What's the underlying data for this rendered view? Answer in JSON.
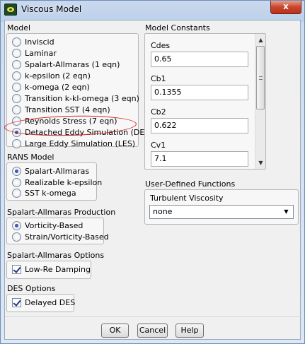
{
  "window": {
    "title": "Viscous Model",
    "close_label": "x"
  },
  "model": {
    "title": "Model",
    "options": [
      {
        "label": "Inviscid",
        "selected": false
      },
      {
        "label": "Laminar",
        "selected": false
      },
      {
        "label": "Spalart-Allmaras (1 eqn)",
        "selected": false
      },
      {
        "label": "k-epsilon (2 eqn)",
        "selected": false
      },
      {
        "label": "k-omega (2 eqn)",
        "selected": false
      },
      {
        "label": "Transition k-kl-omega (3 eqn)",
        "selected": false
      },
      {
        "label": "Transition SST (4 eqn)",
        "selected": false
      },
      {
        "label": "Reynolds Stress (7 eqn)",
        "selected": false
      },
      {
        "label": "Detached Eddy Simulation (DES)",
        "selected": true
      },
      {
        "label": "Large Eddy Simulation (LES)",
        "selected": false
      }
    ]
  },
  "rans_model": {
    "title": "RANS Model",
    "options": [
      {
        "label": "Spalart-Allmaras",
        "selected": true
      },
      {
        "label": "Realizable k-epsilon",
        "selected": false
      },
      {
        "label": "SST k-omega",
        "selected": false
      }
    ]
  },
  "sa_production": {
    "title": "Spalart-Allmaras Production",
    "options": [
      {
        "label": "Vorticity-Based",
        "selected": true
      },
      {
        "label": "Strain/Vorticity-Based",
        "selected": false
      }
    ]
  },
  "sa_options": {
    "title": "Spalart-Allmaras Options",
    "low_re_damping": {
      "label": "Low-Re Damping",
      "checked": true
    }
  },
  "des_options": {
    "title": "DES Options",
    "delayed_des": {
      "label": "Delayed DES",
      "checked": true
    }
  },
  "model_constants": {
    "title": "Model Constants",
    "items": [
      {
        "label": "Cdes",
        "value": "0.65"
      },
      {
        "label": "Cb1",
        "value": "0.1355"
      },
      {
        "label": "Cb2",
        "value": "0.622"
      },
      {
        "label": "Cv1",
        "value": "7.1"
      }
    ]
  },
  "udf": {
    "title": "User-Defined Functions",
    "turbulent_viscosity_label": "Turbulent Viscosity",
    "turbulent_viscosity_value": "none"
  },
  "buttons": {
    "ok": "OK",
    "cancel": "Cancel",
    "help": "Help"
  },
  "colors": {
    "annotation": "#d21c1c",
    "close_button": "#c9452c"
  }
}
